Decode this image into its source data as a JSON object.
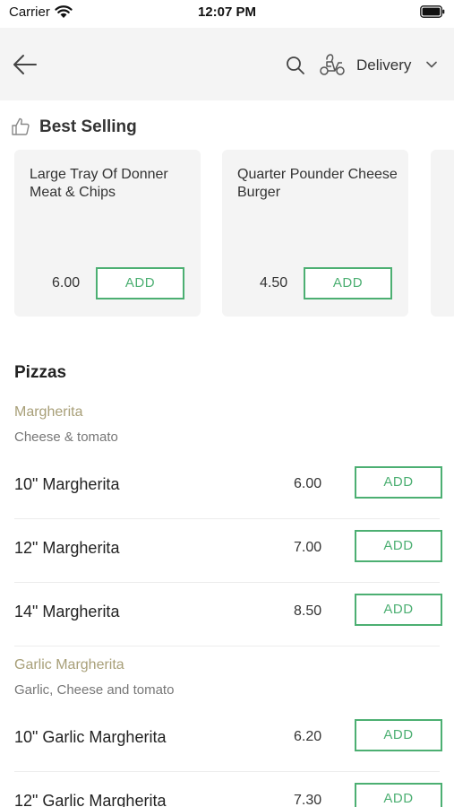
{
  "status_bar": {
    "carrier": "Carrier",
    "time": "12:07 PM"
  },
  "header": {
    "delivery_label": "Delivery"
  },
  "best_selling": {
    "title": "Best Selling",
    "items": [
      {
        "name": "Large Tray Of Donner Meat & Chips",
        "price": "6.00",
        "add_label": "ADD"
      },
      {
        "name": "Quarter Pounder Cheese Burger",
        "price": "4.50",
        "add_label": "ADD"
      }
    ]
  },
  "section": {
    "title": "Pizzas",
    "groups": [
      {
        "title": "Margherita",
        "description": "Cheese & tomato",
        "items": [
          {
            "name": "10\" Margherita",
            "price": "6.00",
            "add_label": "ADD"
          },
          {
            "name": "12\" Margherita",
            "price": "7.00",
            "add_label": "ADD"
          },
          {
            "name": "14\" Margherita",
            "price": "8.50",
            "add_label": "ADD"
          }
        ]
      },
      {
        "title": "Garlic Margherita",
        "description": "Garlic, Cheese and tomato",
        "items": [
          {
            "name": "10\" Garlic Margherita",
            "price": "6.20",
            "add_label": "ADD"
          },
          {
            "name": "12\" Garlic Margherita",
            "price": "7.30",
            "add_label": "ADD"
          }
        ]
      }
    ]
  },
  "colors": {
    "accent_green": "#4caf72",
    "group_title": "#a89f78",
    "header_bg": "#f4f4f4"
  },
  "icons": [
    "wifi-icon",
    "battery-icon",
    "back-arrow-icon",
    "search-icon",
    "scooter-icon",
    "chevron-down-icon",
    "thumbs-up-icon"
  ]
}
